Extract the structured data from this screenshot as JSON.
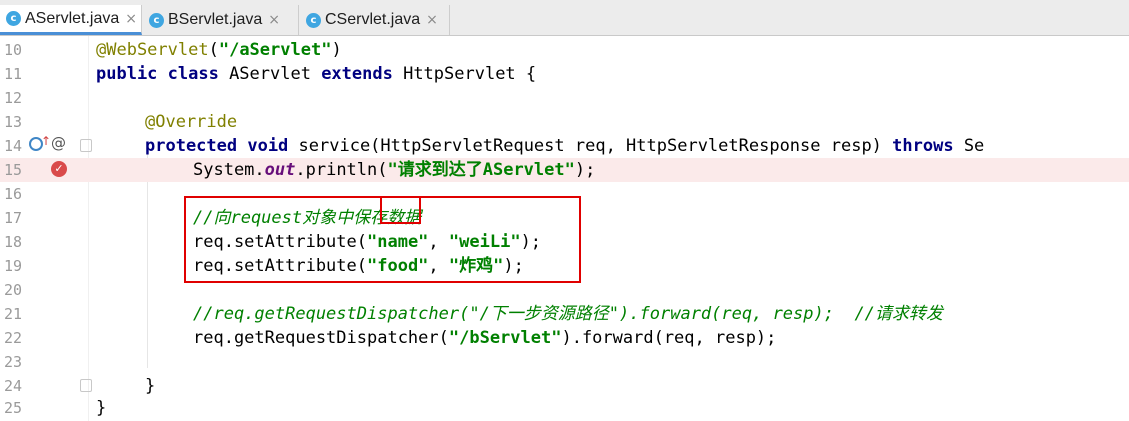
{
  "tabs": [
    {
      "label": "AServlet.java",
      "icon": "c",
      "active": true
    },
    {
      "label": "BServlet.java",
      "icon": "c",
      "active": false
    },
    {
      "label": "CServlet.java",
      "icon": "c",
      "active": false
    }
  ],
  "close_glyph": "×",
  "line_numbers": [
    "10",
    "11",
    "12",
    "13",
    "14",
    "15",
    "16",
    "17",
    "18",
    "19",
    "20",
    "21",
    "22",
    "23",
    "24",
    "25"
  ],
  "code": {
    "l10": {
      "ann": "@WebServlet",
      "p1": "(",
      "str": "\"/aServlet\"",
      "p2": ")"
    },
    "l11": {
      "kw1": "public class",
      "t1": " AServlet ",
      "kw2": "extends",
      "t2": " HttpServlet {"
    },
    "l13": {
      "ann": "@Override"
    },
    "l14": {
      "kw1": "protected void",
      "t1": " service(HttpServletRequest req, HttpServletResponse resp) ",
      "kw2": "throws",
      "t2": " Se"
    },
    "l15": {
      "t1": "System.",
      "fld": "out",
      "t2": ".println(",
      "str": "\"请求到达了AServlet\"",
      "t3": ");"
    },
    "l17": {
      "cmt": "//向request对象中保存数据"
    },
    "l18": {
      "t1": "req.setAttribute(",
      "s1": "\"name\"",
      "t2": ", ",
      "s2": "\"weiLi\"",
      "t3": ");"
    },
    "l19": {
      "t1": "req.setAttribute(",
      "s1": "\"food\"",
      "t2": ", ",
      "s2": "\"炸鸡\"",
      "t3": ");"
    },
    "l21": {
      "cmt": "//req.getRequestDispatcher(\"/下一步资源路径\").forward(req, resp);  //请求转发"
    },
    "l22": {
      "t1": "req.getRequestDispatcher(",
      "str": "\"/bServlet\"",
      "t2": ").forward(req, resp);"
    },
    "l24": {
      "t1": "}"
    },
    "l25": {
      "t1": "}"
    }
  },
  "gutter_icons": {
    "override_glyph": "@",
    "breakpoint_glyph": "✓"
  },
  "colors": {
    "keyword": "#000080",
    "string": "#008000",
    "annotation": "#808000",
    "highlight_line": "#fbeaea",
    "annotation_box": "#e00000"
  }
}
